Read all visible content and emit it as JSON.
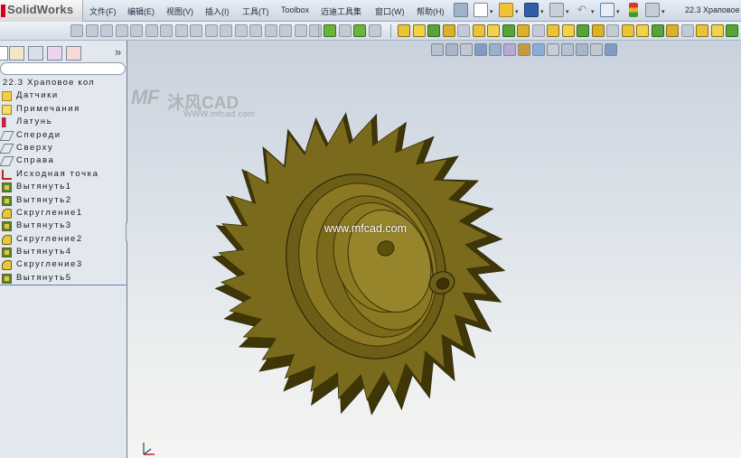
{
  "app": {
    "logo_text": "SolidWorks",
    "document_title": "22.3 Храповое ..."
  },
  "menu": [
    {
      "label": "文件(F)"
    },
    {
      "label": "编辑(E)"
    },
    {
      "label": "视图(V)"
    },
    {
      "label": "插入(I)"
    },
    {
      "label": "工具(T)"
    },
    {
      "label": "Toolbox"
    },
    {
      "label": "迈迪工具集"
    },
    {
      "label": "窗口(W)"
    },
    {
      "label": "帮助(H)"
    }
  ],
  "feature_tree": {
    "root": "22.3 Храповое кол",
    "items": [
      {
        "label": "Датчики",
        "icon": "sensors-icon"
      },
      {
        "label": "Примечания",
        "icon": "annotations-icon"
      },
      {
        "label": "Латунь",
        "icon": "material-icon"
      },
      {
        "label": "Спереди",
        "icon": "plane-icon"
      },
      {
        "label": "Сверху",
        "icon": "plane-icon"
      },
      {
        "label": "Справа",
        "icon": "plane-icon"
      },
      {
        "label": "Исходная точка",
        "icon": "origin-icon"
      },
      {
        "label": "Вытянуть1",
        "icon": "extrude-icon"
      },
      {
        "label": "Вытянуть2",
        "icon": "extrude-icon"
      },
      {
        "label": "Скругление1",
        "icon": "fillet-icon"
      },
      {
        "label": "Вытянуть3",
        "icon": "extrude-icon"
      },
      {
        "label": "Скругление2",
        "icon": "fillet-icon"
      },
      {
        "label": "Вытянуть4",
        "icon": "extrude-icon"
      },
      {
        "label": "Скругление3",
        "icon": "fillet-icon"
      },
      {
        "label": "Вытянуть5",
        "icon": "extrude-icon"
      }
    ]
  },
  "viewport": {
    "watermark_brand": "MF",
    "watermark_cn": "沐风CAD",
    "watermark_url": "WWW.mfcad.com",
    "center_url": "www.mfcad.com"
  },
  "colors": {
    "gear_face": "#7a6a1c",
    "gear_rim": "#3f3608",
    "hub": "#8a7822",
    "accent": "#d6001c"
  }
}
